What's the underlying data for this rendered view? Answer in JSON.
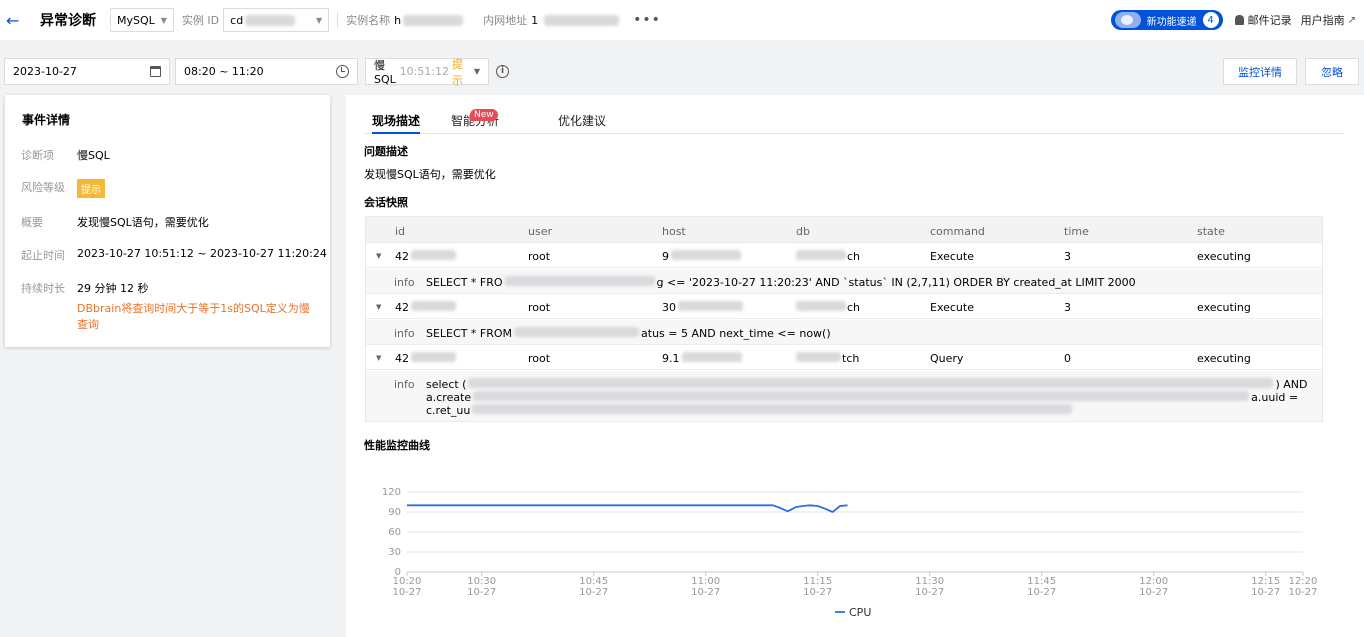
{
  "header": {
    "back_icon": "arrow-left-icon",
    "title": "异常诊断",
    "db_type": "MySQL",
    "instance_id_label": "实例 ID",
    "instance_id_value": "cd",
    "instance_name_label": "实例名称",
    "instance_name_value": "h",
    "intranet_label": "内网地址",
    "intranet_value": "1",
    "more": "•••",
    "new_feature_label": "新功能速递",
    "new_feature_count": "4",
    "mail_label": "邮件记录",
    "guide_label": "用户指南"
  },
  "filters": {
    "date": "2023-10-27",
    "time_range": "08:20 ~ 11:20",
    "event_type": "慢SQL",
    "event_time": "10:51:12",
    "event_level": "提示",
    "monitor_button": "监控详情",
    "ignore_button": "忽略"
  },
  "event_detail": {
    "title": "事件详情",
    "rows": [
      {
        "label": "诊断项",
        "value": "慢SQL"
      },
      {
        "label": "风险等级",
        "value": "提示"
      },
      {
        "label": "概要",
        "value": "发现慢SQL语句，需要优化"
      },
      {
        "label": "起止时间",
        "value": "2023-10-27 10:51:12 ~ 2023-10-27 11:20:24"
      },
      {
        "label": "持续时长",
        "value": "29 分钟 12 秒"
      }
    ],
    "note": "DBbrain将查询时间大于等于1s的SQL定义为慢查询"
  },
  "tabs": [
    {
      "label": "现场描述",
      "active": true
    },
    {
      "label": "智能分析",
      "badge": "New"
    },
    {
      "label": "优化建议"
    }
  ],
  "problem": {
    "heading": "问题描述",
    "text": "发现慢SQL语句，需要优化"
  },
  "session": {
    "heading": "会话快照",
    "columns": [
      "id",
      "user",
      "host",
      "db",
      "command",
      "time",
      "state"
    ],
    "info_label": "info",
    "rows": [
      {
        "id": "42",
        "user": "root",
        "host": "9",
        "db": "ch",
        "command": "Execute",
        "time": "3",
        "state": "executing",
        "info_a": "SELECT * FRO",
        "info_b": "g <= '2023-10-27 11:20:23' AND `status` IN (2,7,11) ORDER BY created_at LIMIT 2000"
      },
      {
        "id": "42",
        "user": "root",
        "host": "30",
        "db": "ch",
        "command": "Execute",
        "time": "3",
        "state": "executing",
        "info_a": "SELECT * FROM",
        "info_b": "atus = 5 AND next_time <= now()"
      },
      {
        "id": "42",
        "user": "root",
        "host": "9.1",
        "db": "tch",
        "command": "Query",
        "time": "0",
        "state": "executing",
        "info_a": "select (",
        "info_b": ") AND",
        "info_c": "a.create",
        "info_d": "a.uuid =",
        "info_e": "c.ret_uu"
      }
    ]
  },
  "monitor": {
    "heading": "性能监控曲线"
  },
  "chart_data": {
    "type": "line",
    "title": "",
    "xlabel": "",
    "ylabel": "",
    "ylim": [
      0,
      120
    ],
    "yticks": [
      0,
      30,
      60,
      90,
      120
    ],
    "xtick_labels": [
      [
        "10:20",
        "10-27"
      ],
      [
        "10:30",
        "10-27"
      ],
      [
        "10:45",
        "10-27"
      ],
      [
        "11:00",
        "10-27"
      ],
      [
        "11:15",
        "10-27"
      ],
      [
        "11:30",
        "10-27"
      ],
      [
        "11:45",
        "10-27"
      ],
      [
        "12:00",
        "10-27"
      ],
      [
        "12:15",
        "10-27"
      ],
      [
        "12:20",
        "10-27"
      ]
    ],
    "xtick_minutes": [
      0,
      10,
      25,
      40,
      55,
      70,
      85,
      100,
      115,
      120
    ],
    "x_range_minutes": [
      0,
      120
    ],
    "grid": true,
    "legend": "bottom",
    "series": [
      {
        "name": "CPU",
        "color": "#2f6fe4",
        "x": [
          0,
          49,
          50,
          51,
          52,
          53,
          54,
          55,
          56,
          57,
          58,
          59
        ],
        "y": [
          100,
          100,
          96,
          91,
          97,
          99,
          100,
          99,
          95,
          90,
          99,
          100
        ]
      }
    ]
  }
}
